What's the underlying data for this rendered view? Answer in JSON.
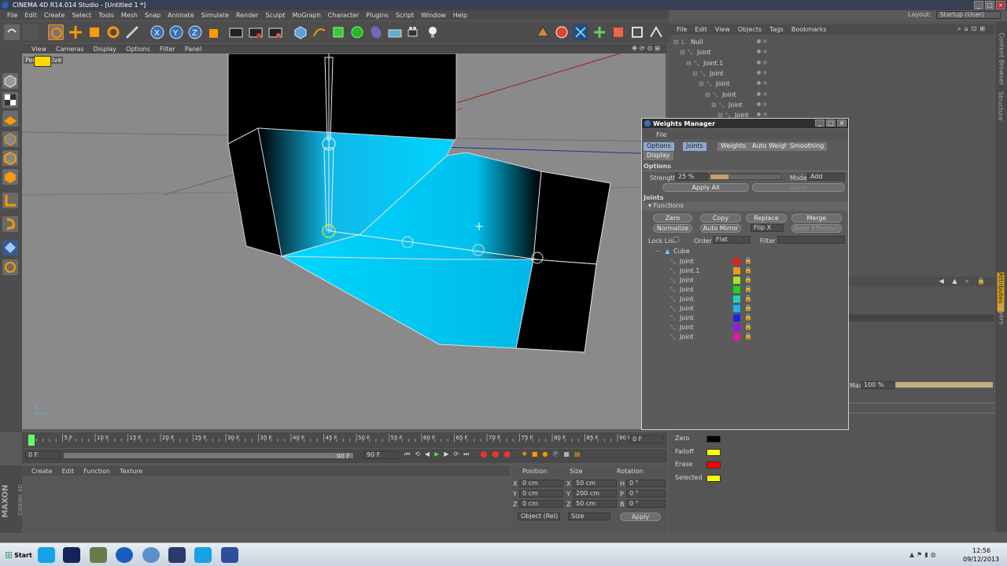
{
  "window": {
    "title": "CINEMA 4D R14.014 Studio - [Untitled 1 *]"
  },
  "menubar": [
    "File",
    "Edit",
    "Create",
    "Select",
    "Tools",
    "Mesh",
    "Snap",
    "Animate",
    "Simulate",
    "Render",
    "Sculpt",
    "MoGraph",
    "Character",
    "Plugins",
    "Script",
    "Window",
    "Help"
  ],
  "layout": {
    "label": "Layout:",
    "value": "Startup (User)"
  },
  "viewport": {
    "menu": [
      "View",
      "Cameras",
      "Display",
      "Options",
      "Filter",
      "Panel"
    ],
    "name": "Perspective"
  },
  "timeline": {
    "ticks": [
      "0",
      "5 F",
      "10 F",
      "15 F",
      "20 F",
      "25 F",
      "30 F",
      "35 F",
      "40 F",
      "45 F",
      "50 F",
      "55 F",
      "60 F",
      "65 F",
      "70 F",
      "75 F",
      "80 F",
      "85 F",
      "90 F"
    ],
    "frame_field": "0 F"
  },
  "transport": {
    "start": "0 F",
    "range_end": "90 F",
    "end": "90 F"
  },
  "material": {
    "menu": [
      "Create",
      "Edit",
      "Function",
      "Texture"
    ]
  },
  "coords": {
    "headers": [
      "Position",
      "Size",
      "Rotation"
    ],
    "rows": [
      {
        "axis": "X",
        "pos": "0 cm",
        "saxis": "X",
        "size": "50 cm",
        "raxis": "H",
        "rot": "0 °"
      },
      {
        "axis": "Y",
        "pos": "0 cm",
        "saxis": "Y",
        "size": "200 cm",
        "raxis": "P",
        "rot": "0 °"
      },
      {
        "axis": "Z",
        "pos": "0 cm",
        "saxis": "Z",
        "size": "50 cm",
        "raxis": "B",
        "rot": "0 °"
      }
    ],
    "mode": "Object (Rel)",
    "size_mode": "Size",
    "apply": "Apply"
  },
  "brand": {
    "maxon": "MAXON",
    "product": "CINEMA 4D"
  },
  "objects": {
    "menu": [
      "File",
      "Edit",
      "View",
      "Objects",
      "Tags",
      "Bookmarks"
    ],
    "tree": [
      {
        "name": "Null",
        "indent": 0
      },
      {
        "name": "Joint",
        "indent": 1
      },
      {
        "name": "Joint.1",
        "indent": 2
      },
      {
        "name": "Joint",
        "indent": 3
      },
      {
        "name": "Joint",
        "indent": 4
      },
      {
        "name": "Joint",
        "indent": 5
      },
      {
        "name": "Joint",
        "indent": 6
      },
      {
        "name": "Joint",
        "indent": 7
      }
    ]
  },
  "sidetabs": [
    "Content Browser",
    "Structure",
    "Attributes",
    "Layers"
  ],
  "weights_manager": {
    "title": "Weights Manager",
    "menu": "File",
    "tabs": [
      "Options",
      "Joints",
      "Weights",
      "Auto Weight",
      "Smoothing",
      "Display"
    ],
    "options_title": "Options",
    "strength_label": "Strength",
    "strength_value": "25 %",
    "strength_fraction": 0.25,
    "mode_label": "Mode",
    "mode_value": "Add",
    "apply_all": "Apply All",
    "apply": "Apply",
    "joints_title": "Joints",
    "functions_title": "Functions",
    "buttons": [
      "Zero",
      "Copy",
      "Replace",
      "Merge",
      "Normalize",
      "Auto Mirror",
      "Flip X",
      "Bake Effectors"
    ],
    "lock_list": "Lock List",
    "order_label": "Order",
    "order_value": "Flat",
    "filter_label": "Filter",
    "mesh": "Cube",
    "joints": [
      {
        "name": "Joint",
        "color": "#e52020"
      },
      {
        "name": "Joint.1",
        "color": "#f29a1a"
      },
      {
        "name": "Joint",
        "color": "#a8e61d"
      },
      {
        "name": "Joint",
        "color": "#1fd31f"
      },
      {
        "name": "Joint",
        "color": "#19d6b4"
      },
      {
        "name": "Joint",
        "color": "#17b3ff"
      },
      {
        "name": "Joint",
        "color": "#1b22e6"
      },
      {
        "name": "Joint",
        "color": "#9a17e6"
      },
      {
        "name": "Joint",
        "color": "#e617a8"
      }
    ]
  },
  "attributes": {
    "max_label": "Max",
    "max_value": "100 %"
  },
  "prefs": [
    {
      "label": "Zero",
      "color": "#000000"
    },
    {
      "label": "Falloff",
      "color": "#ffff00"
    },
    {
      "label": "Erase",
      "color": "#ff0000"
    },
    {
      "label": "Selected",
      "color": "#ffff00"
    }
  ],
  "taskbar": {
    "start": "Start",
    "time": "12:56",
    "date": "09/12/2013"
  }
}
